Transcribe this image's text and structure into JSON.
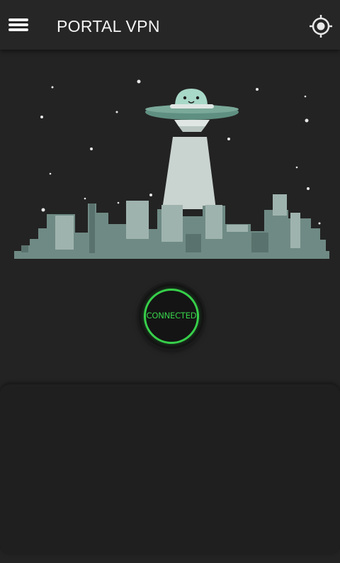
{
  "app": {
    "title": "PORTAL VPN"
  },
  "header": {
    "menu_icon": "hamburger-menu-icon",
    "location_icon": "crosshair-location-icon"
  },
  "connection": {
    "status": "CONNECTED",
    "status_color": "#37d04a"
  },
  "colors": {
    "background": "#232323",
    "appbar": "#262626",
    "city": "#6f8a84",
    "ufo": "#5f8f80",
    "beam": "#c9d3cf"
  }
}
